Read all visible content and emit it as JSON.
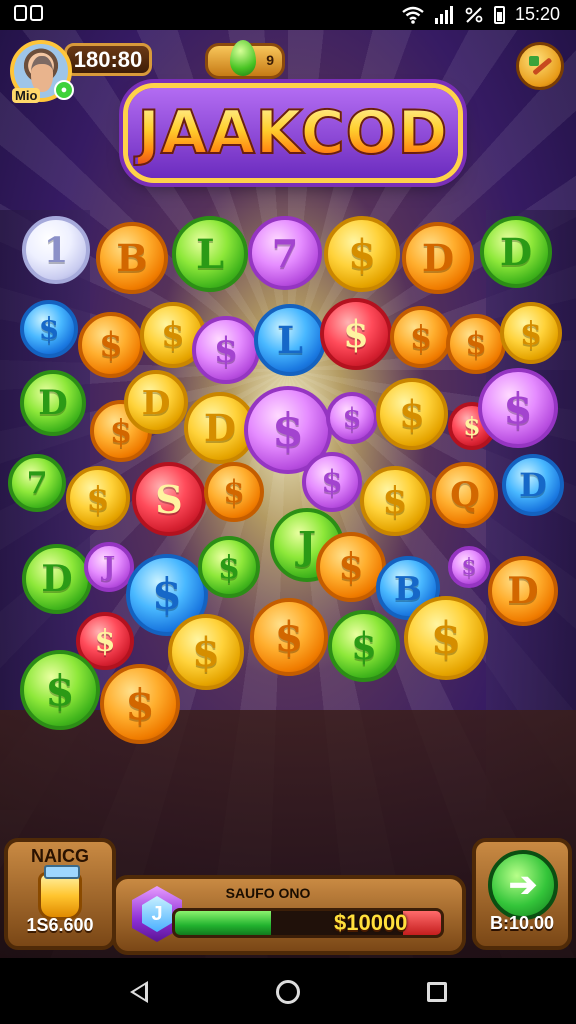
{
  "status_bar": {
    "time": "15:20",
    "icons": [
      "notification-icon",
      "wifi-icon",
      "signal-icon",
      "no-data-icon",
      "battery-icon"
    ]
  },
  "header": {
    "player_name": "Mio",
    "score": "180:80",
    "gem_label": "9"
  },
  "title": "JAAKCOD",
  "coins": [
    {
      "color": "white",
      "symbol": "1"
    },
    {
      "color": "orange",
      "symbol": "B"
    },
    {
      "color": "green",
      "symbol": "L"
    },
    {
      "color": "purple",
      "symbol": "7"
    },
    {
      "color": "gold",
      "symbol": "$"
    },
    {
      "color": "orange",
      "symbol": "D"
    },
    {
      "color": "green",
      "symbol": "D"
    },
    {
      "color": "blue",
      "symbol": "$"
    },
    {
      "color": "orange",
      "symbol": "$"
    },
    {
      "color": "gold",
      "symbol": "$"
    },
    {
      "color": "purple",
      "symbol": "$"
    },
    {
      "color": "blue",
      "symbol": "L"
    },
    {
      "color": "red",
      "symbol": "$"
    },
    {
      "color": "orange",
      "symbol": "$"
    },
    {
      "color": "orange",
      "symbol": "$"
    },
    {
      "color": "gold",
      "symbol": "$"
    },
    {
      "color": "green",
      "symbol": "D"
    },
    {
      "color": "orange",
      "symbol": "$"
    },
    {
      "color": "gold",
      "symbol": "D"
    },
    {
      "color": "gold",
      "symbol": "D"
    },
    {
      "color": "purple",
      "symbol": "$"
    },
    {
      "color": "purple",
      "symbol": "$"
    },
    {
      "color": "gold",
      "symbol": "$"
    },
    {
      "color": "red",
      "symbol": "$"
    },
    {
      "color": "purple",
      "symbol": "$"
    },
    {
      "color": "green",
      "symbol": "7"
    },
    {
      "color": "gold",
      "symbol": "$"
    },
    {
      "color": "red",
      "symbol": "S"
    },
    {
      "color": "orange",
      "symbol": "$"
    },
    {
      "color": "green",
      "symbol": "J"
    },
    {
      "color": "purple",
      "symbol": "$"
    },
    {
      "color": "gold",
      "symbol": "$"
    },
    {
      "color": "orange",
      "symbol": "Q"
    },
    {
      "color": "blue",
      "symbol": "D"
    },
    {
      "color": "green",
      "symbol": "D"
    },
    {
      "color": "purple",
      "symbol": "J"
    },
    {
      "color": "blue",
      "symbol": "$"
    },
    {
      "color": "green",
      "symbol": "$"
    },
    {
      "color": "orange",
      "symbol": "$"
    },
    {
      "color": "blue",
      "symbol": "B"
    },
    {
      "color": "gold",
      "symbol": "$"
    },
    {
      "color": "purple",
      "symbol": "$"
    },
    {
      "color": "orange",
      "symbol": "D"
    },
    {
      "color": "red",
      "symbol": "$"
    },
    {
      "color": "gold",
      "symbol": "$"
    },
    {
      "color": "orange",
      "symbol": "$"
    },
    {
      "color": "green",
      "symbol": "$"
    },
    {
      "color": "green",
      "symbol": "$"
    },
    {
      "color": "orange",
      "symbol": "$"
    }
  ],
  "bottom": {
    "left_title": "NAICG",
    "left_value": "1S6.600",
    "progress_label": "SAUFO ONO",
    "progress_value": "$10000",
    "progress_fill": 0.36,
    "gem_symbol": "J",
    "next_value": "B:10.00",
    "next_symbol": "➔"
  },
  "nav": {
    "buttons": [
      "back-button",
      "home-button",
      "recents-button"
    ]
  }
}
